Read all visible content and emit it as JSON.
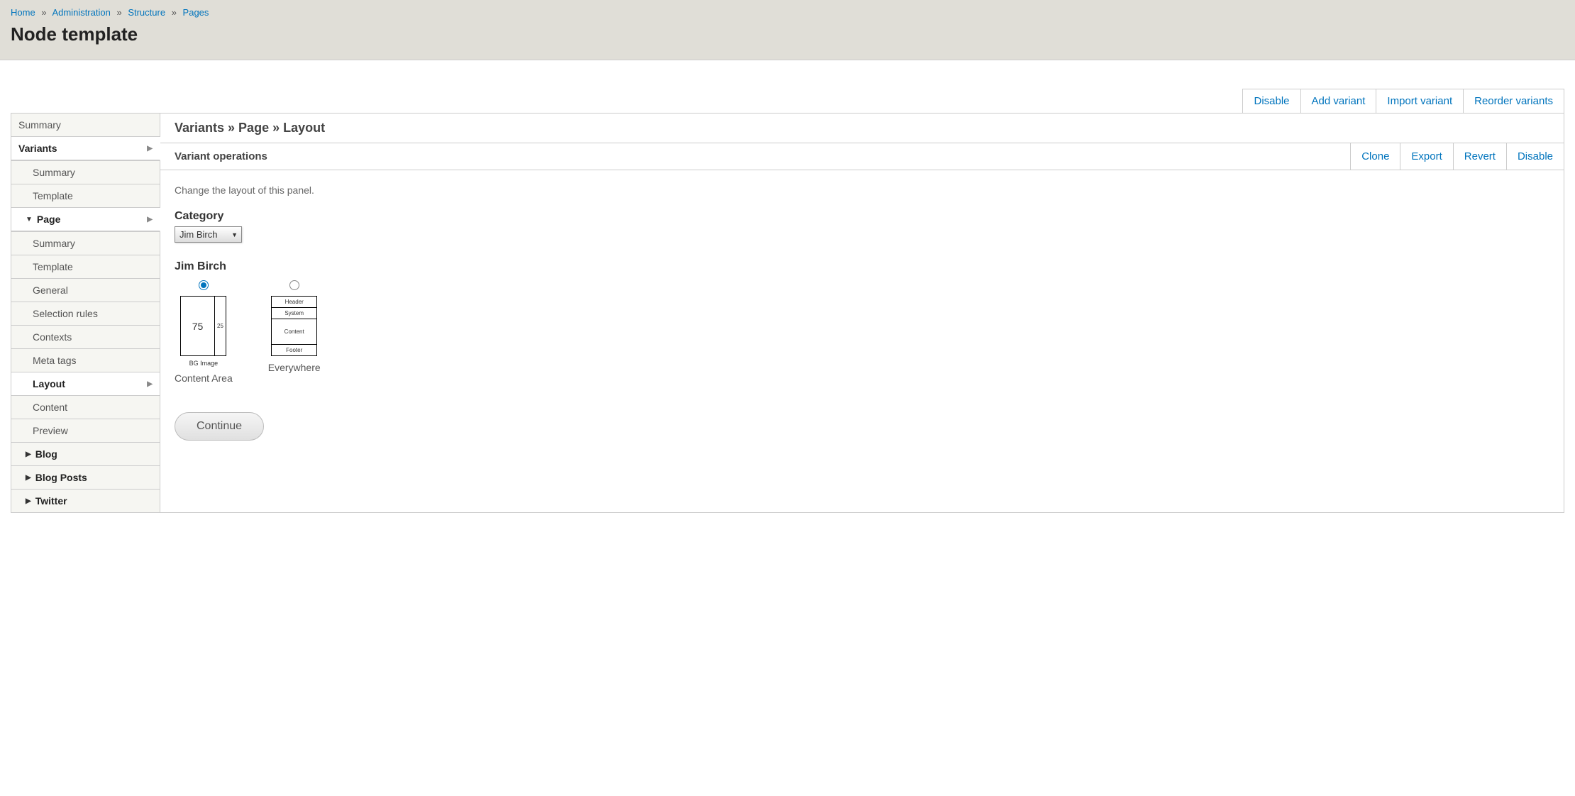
{
  "breadcrumb": {
    "items": [
      "Home",
      "Administration",
      "Structure",
      "Pages"
    ],
    "sep": "»"
  },
  "page_title": "Node template",
  "top_actions": [
    "Disable",
    "Add variant",
    "Import variant",
    "Reorder variants"
  ],
  "sidebar": {
    "summary": "Summary",
    "variants": "Variants",
    "variants_children": {
      "summary": "Summary",
      "template": "Template"
    },
    "page": "Page",
    "page_children": {
      "summary": "Summary",
      "template": "Template",
      "general": "General",
      "selection_rules": "Selection rules",
      "contexts": "Contexts",
      "meta_tags": "Meta tags",
      "layout": "Layout",
      "content": "Content",
      "preview": "Preview"
    },
    "blog": "Blog",
    "blog_posts": "Blog Posts",
    "twitter": "Twitter"
  },
  "content": {
    "header": "Variants » Page » Layout",
    "variant_ops_title": "Variant operations",
    "variant_ops": [
      "Clone",
      "Export",
      "Revert",
      "Disable"
    ],
    "description": "Change the layout of this panel.",
    "category_label": "Category",
    "category_value": "Jim Birch",
    "layouts_title": "Jim Birch",
    "layout_a": {
      "col1": "75",
      "col2": "25",
      "sublabel": "BG Image",
      "caption": "Content Area"
    },
    "layout_b": {
      "rows": [
        "Header",
        "System",
        "Content",
        "Footer"
      ],
      "caption": "Everywhere"
    },
    "continue": "Continue"
  }
}
